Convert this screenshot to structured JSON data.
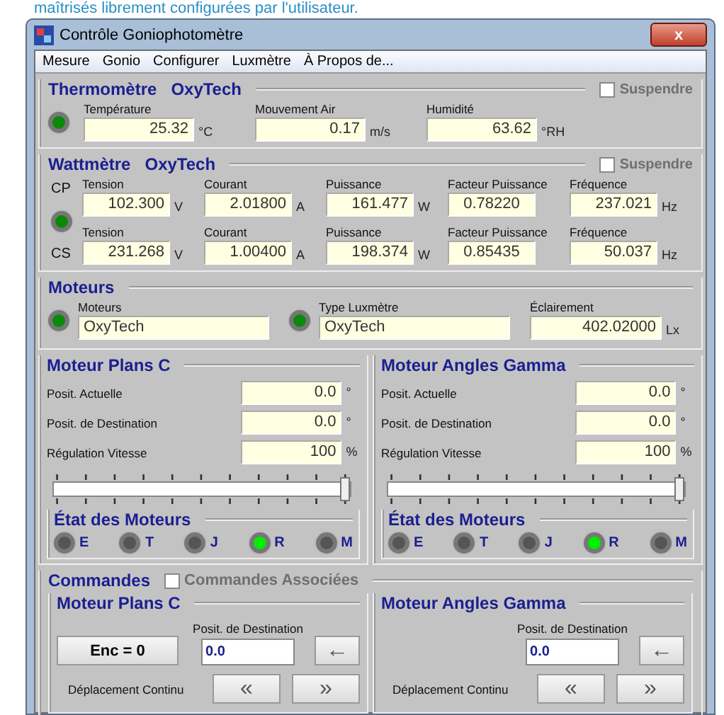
{
  "page_caption": "maîtrisés librement configurées par l'utilisateur.",
  "window": {
    "title": "Contrôle Goniophotomètre",
    "close": "x"
  },
  "menu": [
    {
      "label": "Mesure"
    },
    {
      "label": "Gonio"
    },
    {
      "label": "Configurer"
    },
    {
      "label": "Luxmètre"
    },
    {
      "label": "À Propos de..."
    }
  ],
  "thermometer": {
    "title": "Thermomètre",
    "brand": "OxyTech",
    "suspend": {
      "label": "Suspendre",
      "checked": false,
      "disabled": true
    },
    "led": {
      "on": true
    },
    "fields": [
      {
        "label": "Température",
        "value": "25.32",
        "unit": "°C"
      },
      {
        "label": "Mouvement Air",
        "value": "0.17",
        "unit": "m/s"
      },
      {
        "label": "Humidité",
        "value": "63.62",
        "unit": "°RH"
      }
    ]
  },
  "wattmeter": {
    "title": "Wattmètre",
    "brand": "OxyTech",
    "suspend": {
      "label": "Suspendre",
      "checked": false,
      "disabled": true
    },
    "led": {
      "on": true
    },
    "rows": [
      {
        "phase": "CP",
        "fields": [
          {
            "label": "Tension",
            "value": "102.300",
            "unit": "V"
          },
          {
            "label": "Courant",
            "value": "2.01800",
            "unit": "A"
          },
          {
            "label": "Puissance",
            "value": "161.477",
            "unit": "W"
          },
          {
            "label": "Facteur Puissance",
            "value": "0.78220"
          },
          {
            "label": "Fréquence",
            "value": "237.021",
            "unit": "Hz"
          }
        ]
      },
      {
        "phase": "CS",
        "fields": [
          {
            "label": "Tension",
            "value": "231.268",
            "unit": "V"
          },
          {
            "label": "Courant",
            "value": "1.00400",
            "unit": "A"
          },
          {
            "label": "Puissance",
            "value": "198.374",
            "unit": "W"
          },
          {
            "label": "Facteur Puissance",
            "value": "0.85435"
          },
          {
            "label": "Fréquence",
            "value": "50.037",
            "unit": "Hz"
          }
        ]
      }
    ]
  },
  "motors": {
    "title": "Moteurs",
    "items": [
      {
        "label": "Moteurs",
        "value": "OxyTech",
        "led": {
          "on": true
        }
      },
      {
        "label": "Type Luxmètre",
        "value": "OxyTech",
        "led": {
          "on": true
        }
      }
    ],
    "illuminance": {
      "label": "Éclairement",
      "value": "402.02000",
      "unit": "Lx"
    }
  },
  "axes": [
    {
      "title": "Moteur Plans C",
      "rows": [
        {
          "label": "Posit. Actuelle",
          "value": "0.0",
          "unit": "°"
        },
        {
          "label": "Posit. de Destination",
          "value": "0.0",
          "unit": "°"
        },
        {
          "label": "Régulation Vitesse",
          "value": "100",
          "unit": "%"
        }
      ],
      "slider": {
        "level": 1
      },
      "status": {
        "title": "État des Moteurs",
        "leds": [
          {
            "label": "E",
            "on": false
          },
          {
            "label": "T",
            "on": false
          },
          {
            "label": "J",
            "on": false
          },
          {
            "label": "R",
            "on": true
          },
          {
            "label": "M",
            "on": false
          }
        ]
      }
    },
    {
      "title": "Moteur Angles Gamma",
      "rows": [
        {
          "label": "Posit. Actuelle",
          "value": "0.0",
          "unit": "°"
        },
        {
          "label": "Posit. de Destination",
          "value": "0.0",
          "unit": "°"
        },
        {
          "label": "Régulation Vitesse",
          "value": "100",
          "unit": "%"
        }
      ],
      "slider": {
        "level": 1
      },
      "status": {
        "title": "État des Moteurs",
        "leds": [
          {
            "label": "E",
            "on": false
          },
          {
            "label": "T",
            "on": false
          },
          {
            "label": "J",
            "on": false
          },
          {
            "label": "R",
            "on": true
          },
          {
            "label": "M",
            "on": false
          }
        ]
      }
    }
  ],
  "commands": {
    "title": "Commandes",
    "associated": {
      "label": "Commandes Associées",
      "checked": false,
      "disabled": true
    },
    "panels": [
      {
        "title": "Moteur Plans C",
        "reset_button": "Enc = 0",
        "dest_label": "Posit. de Destination",
        "dest_value": "0.0",
        "go_button": "←",
        "continuous_label": "Déplacement Continu",
        "back_button": "«",
        "forward_button": "»"
      },
      {
        "title": "Moteur Angles Gamma",
        "dest_label": "Posit. de Destination",
        "dest_value": "0.0",
        "go_button": "←",
        "continuous_label": "Déplacement Continu",
        "back_button": "«",
        "forward_button": "»"
      }
    ]
  }
}
